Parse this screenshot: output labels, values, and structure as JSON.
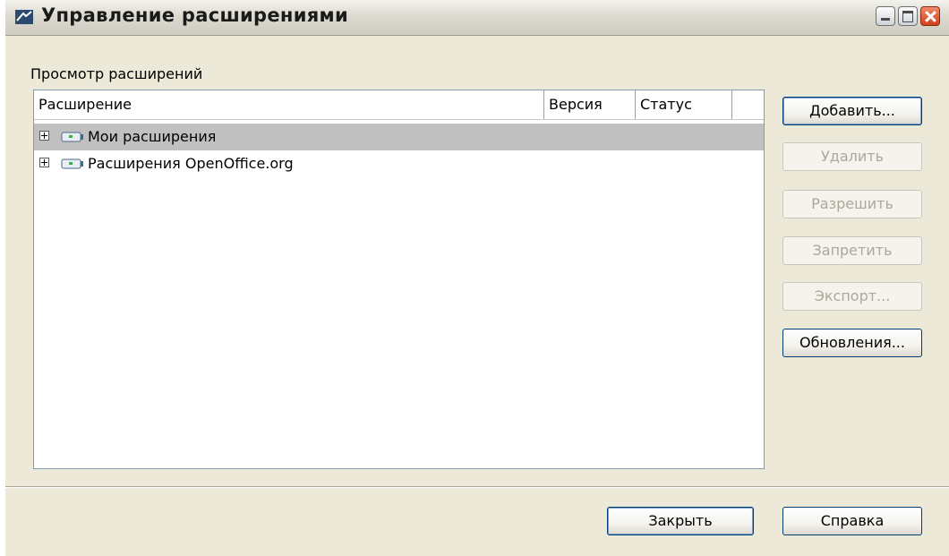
{
  "window": {
    "title": "Управление расширениями",
    "controls": [
      "minimize-icon",
      "maximize-icon",
      "close-icon"
    ]
  },
  "list": {
    "label": "Просмотр расширений",
    "columns": [
      "Расширение",
      "Версия",
      "Статус"
    ],
    "rows": [
      {
        "label": "Мои расширения",
        "selected": true
      },
      {
        "label": "Расширения OpenOffice.org",
        "selected": false
      }
    ]
  },
  "buttons": {
    "add": "Добавить...",
    "remove": "Удалить",
    "enable": "Разрешить",
    "disable": "Запретить",
    "export": "Экспорт...",
    "updates": "Обновления...",
    "close": "Закрыть",
    "help": "Справка"
  },
  "colors": {
    "selection": "#c0c0c0",
    "disabled_text": "#aca899",
    "dialog_bg": "#ece9d8"
  }
}
